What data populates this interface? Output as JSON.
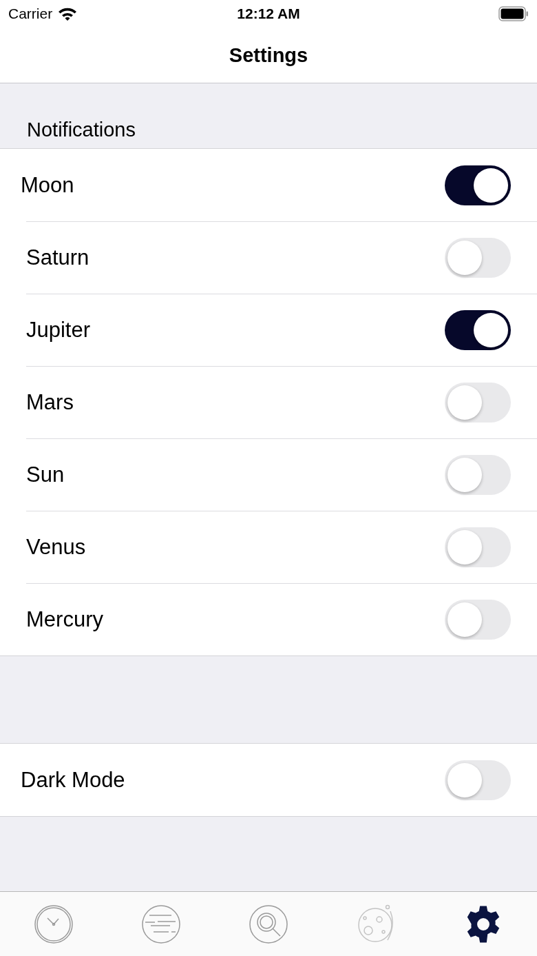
{
  "status_bar": {
    "carrier": "Carrier",
    "time": "12:12 AM"
  },
  "nav_bar": {
    "title": "Settings"
  },
  "notifications": {
    "header": "Notifications",
    "items": [
      {
        "label": "Moon",
        "on": true
      },
      {
        "label": "Saturn",
        "on": false
      },
      {
        "label": "Jupiter",
        "on": true
      },
      {
        "label": "Mars",
        "on": false
      },
      {
        "label": "Sun",
        "on": false
      },
      {
        "label": "Venus",
        "on": false
      },
      {
        "label": "Mercury",
        "on": false
      }
    ]
  },
  "appearance": {
    "items": [
      {
        "label": "Dark Mode",
        "on": false
      }
    ]
  },
  "tab_bar": {
    "items": [
      {
        "kind": "clock",
        "selected": false
      },
      {
        "kind": "planet",
        "selected": false
      },
      {
        "kind": "search",
        "selected": false
      },
      {
        "kind": "moon",
        "selected": false
      },
      {
        "kind": "settings",
        "selected": true
      }
    ]
  }
}
